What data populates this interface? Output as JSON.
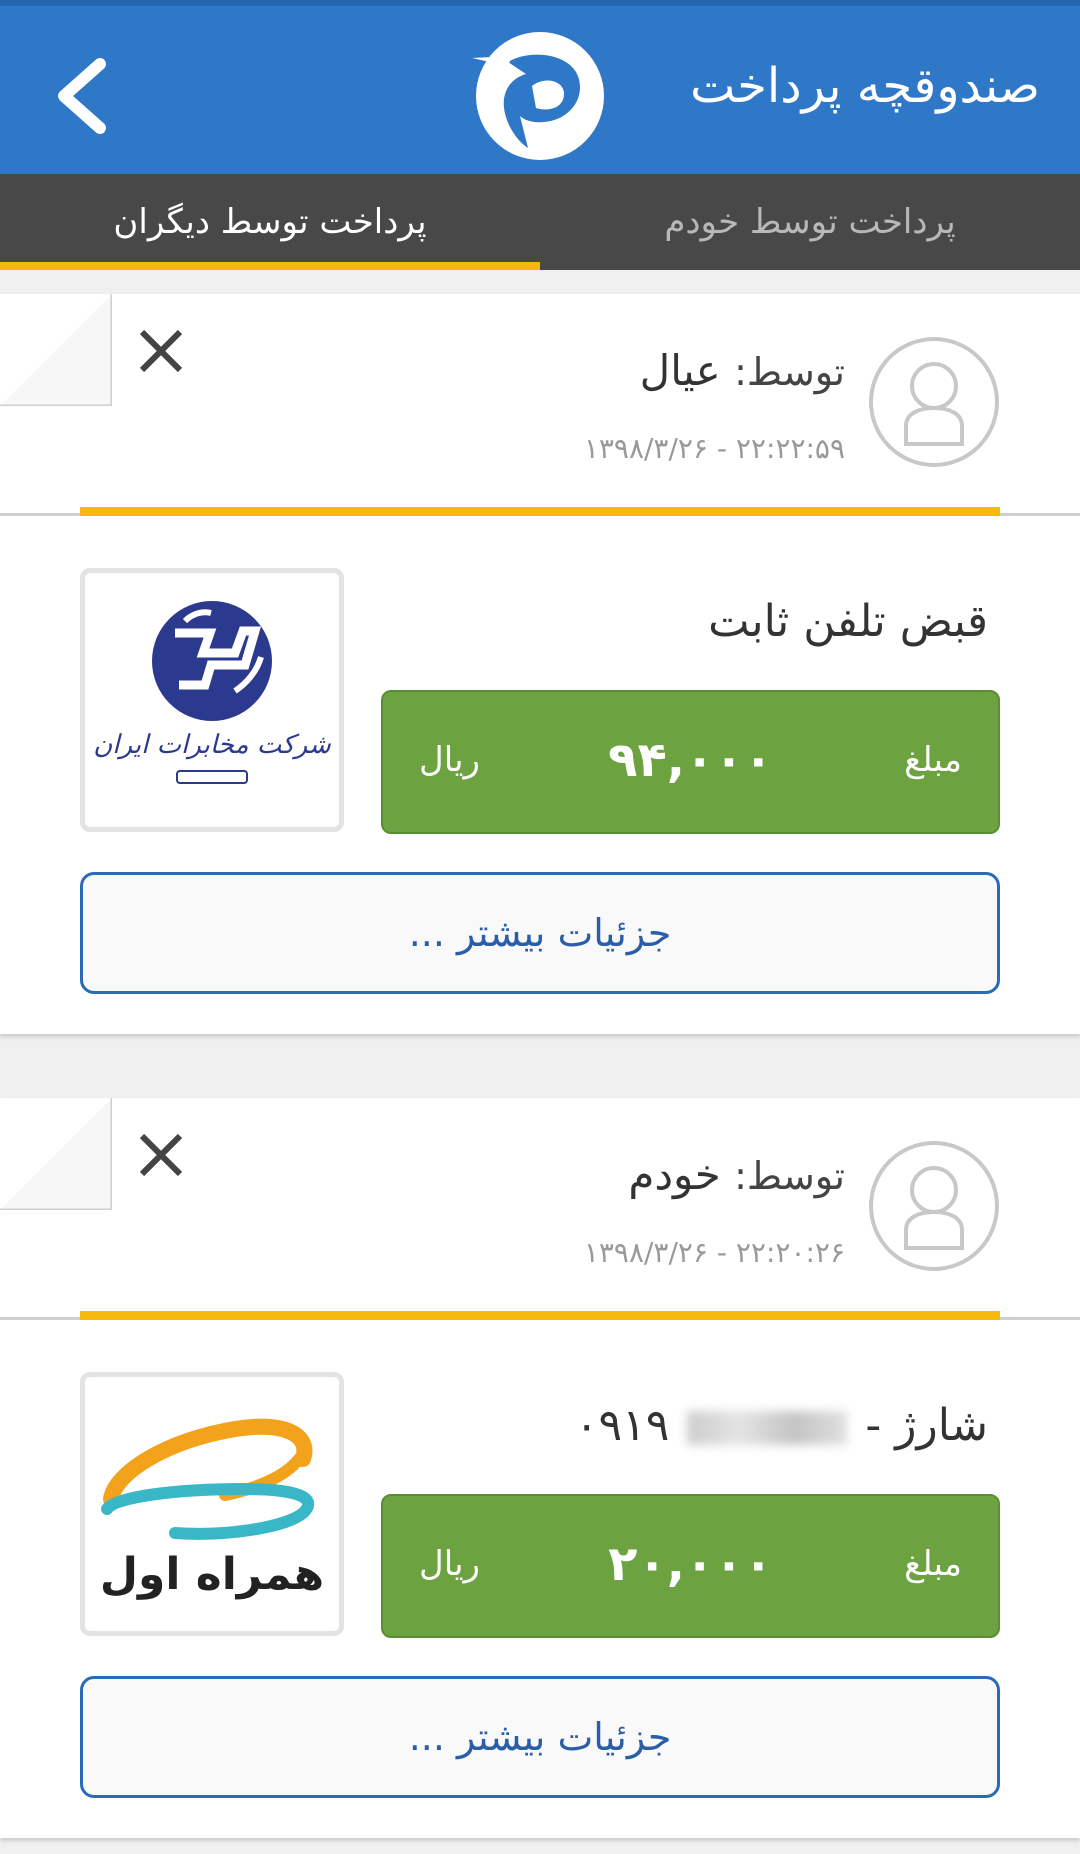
{
  "header": {
    "title": "صندوقچه پرداخت",
    "colors": {
      "bar": "#2e78c7",
      "accent": "#f5b80b"
    }
  },
  "tabs": [
    {
      "label": "پرداخت توسط خودم",
      "active": false
    },
    {
      "label": "پرداخت توسط دیگران",
      "active": true
    }
  ],
  "payments": [
    {
      "by_label": "توسط:",
      "by_name": "عیال",
      "timestamp": "۱۳۹۸/۳/۲۶ - ۲۲:۲۲:۵۹",
      "service": "قبض تلفن ثابت",
      "service_logo": "telecommunication-iran-logo",
      "logo_text": "شرکت مخابرات ایران",
      "amount_label": "مبلغ",
      "amount": "۹۴,۰۰۰",
      "unit": "ریال",
      "details_label": "جزئیات بیشتر ..."
    },
    {
      "by_label": "توسط:",
      "by_name": "خودم",
      "timestamp": "۱۳۹۸/۳/۲۶ - ۲۲:۲۰:۲۶",
      "service_prefix": "شارژ -",
      "phone_visible": "۰۹۱۹",
      "service_logo": "hamrah-aval-logo",
      "logo_text": "همراه اول",
      "amount_label": "مبلغ",
      "amount": "۲۰,۰۰۰",
      "unit": "ریال",
      "details_label": "جزئیات بیشتر ..."
    }
  ]
}
